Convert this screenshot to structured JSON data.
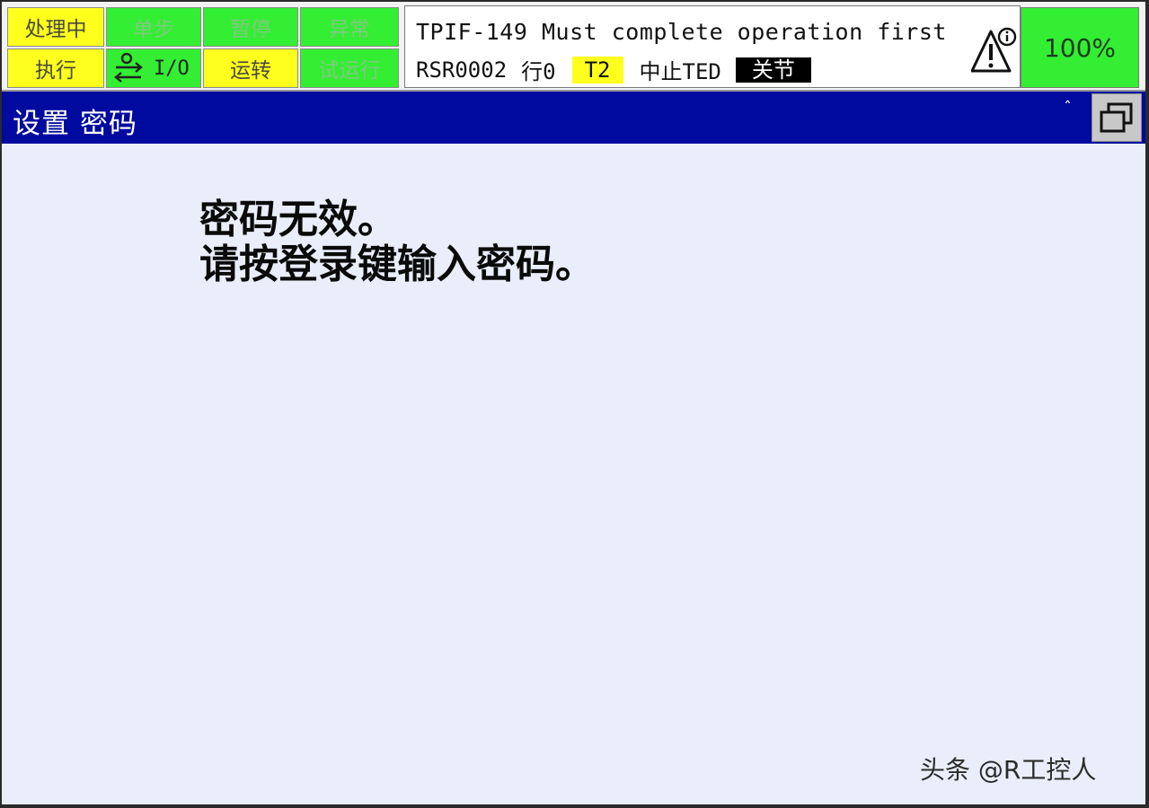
{
  "status_buttons": {
    "busy": "处理中",
    "step": "单步",
    "hold": "暂停",
    "fault": "异常",
    "run": "执行",
    "io": "I/O",
    "prod": "运转",
    "tcyc": "试运行"
  },
  "message": {
    "line1": "TPIF-149 Must complete operation first",
    "program": "RSR0002",
    "line": "行0",
    "mode": "T2",
    "state": "中止TED",
    "coord": "关节"
  },
  "override": "100%",
  "title": {
    "text": "设置  密码",
    "caret": "ˆ"
  },
  "content": {
    "invalid": "密码无效。",
    "instruction": "请按登录键输入密码。"
  },
  "watermark": "头条 @R工控人",
  "colors": {
    "yellow": "#ffff1e",
    "green": "#33ee33",
    "title_bar": "#000a9e",
    "background": "#e9eefa"
  },
  "icons": {
    "io": "io-transfer-icon",
    "warning": "warning-info-icon",
    "window": "window-switch-icon"
  }
}
